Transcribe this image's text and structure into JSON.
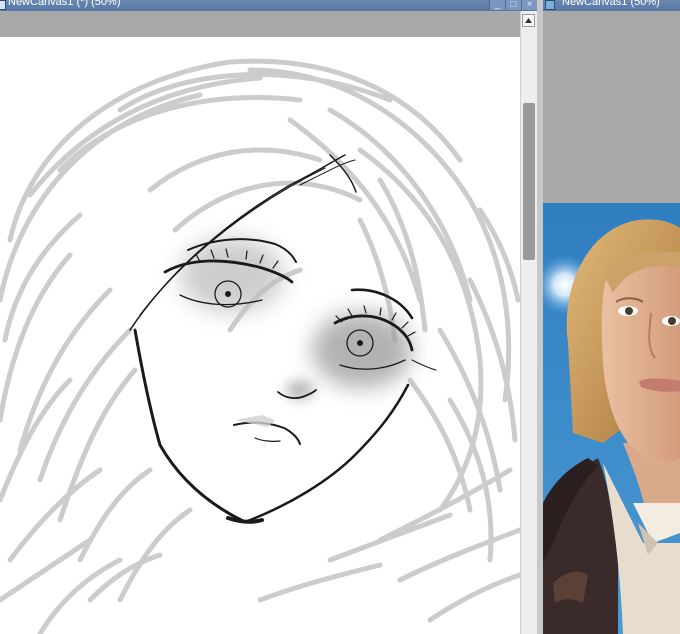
{
  "left_window": {
    "title": "NewCanvas1 (*) (50%)",
    "buttons": {
      "minimize": "_",
      "maximize": "□",
      "close": "×"
    },
    "content": "line-art-sketch"
  },
  "right_window": {
    "title": "NewCanvas1 (50%)",
    "content": "reference-photo"
  },
  "colors": {
    "titlebar": "#5b7aa8",
    "workspace": "#a9a9a9",
    "canvas": "#ffffff",
    "sketch_gray": "#cccccc",
    "ink": "#1a1a1a",
    "scroll_thumb": "#999999",
    "photo_sky": "#3f8fc9"
  },
  "icons": [
    "canvas-window-icon",
    "scroll-up-arrow-icon"
  ]
}
